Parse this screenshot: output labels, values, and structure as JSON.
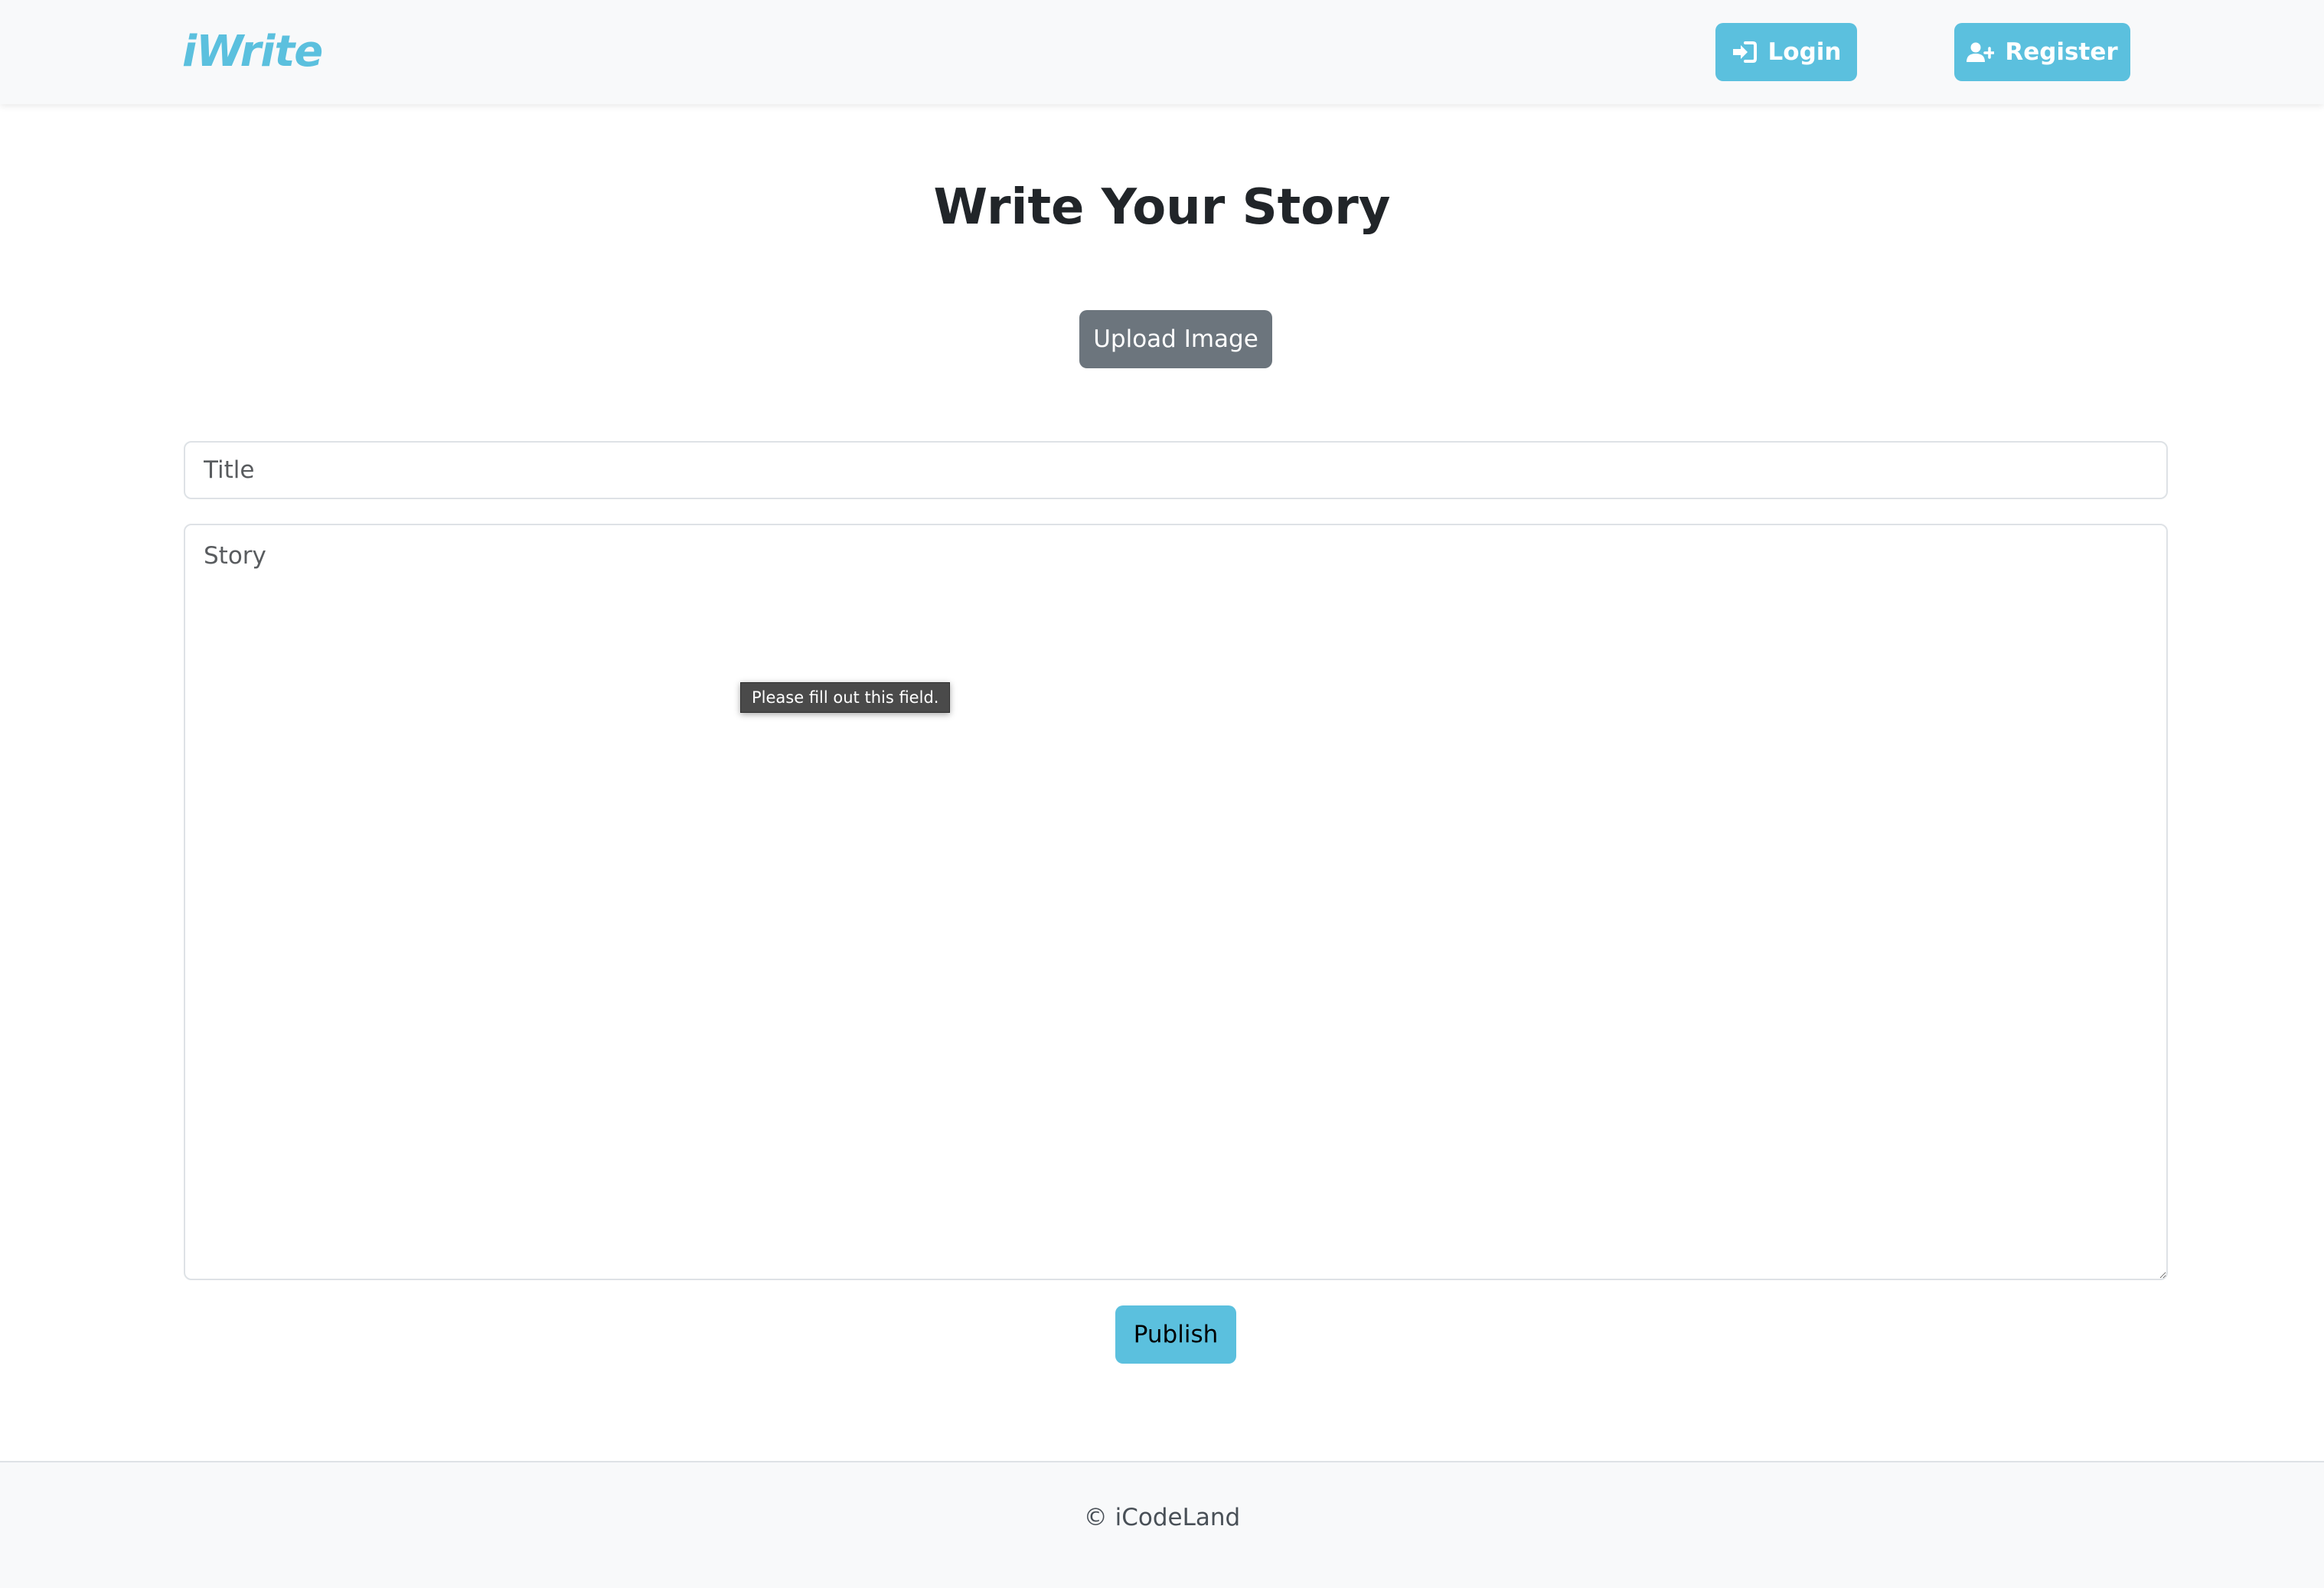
{
  "navbar": {
    "brand": "iWrite",
    "login_label": "Login",
    "login_icon": "sign-in-icon",
    "register_label": "Register",
    "register_icon": "user-plus-icon"
  },
  "main": {
    "title": "Write Your Story",
    "upload_label": "Upload Image",
    "title_placeholder": "Title",
    "story_placeholder": "Story",
    "validation_tooltip": "Please fill out this field.",
    "publish_label": "Publish"
  },
  "footer": {
    "text": "© iCodeLand"
  },
  "colors": {
    "accent": "#5bc0de",
    "secondary_button": "#6c757d",
    "nav_background": "#f8f9fa"
  }
}
